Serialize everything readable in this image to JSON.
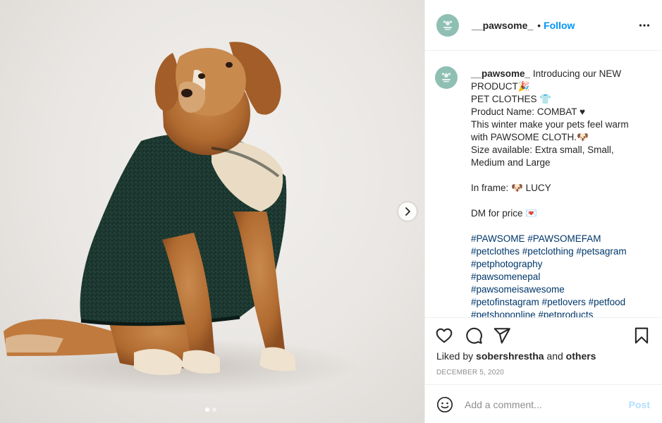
{
  "post": {
    "username": "__pawsome_",
    "follow_label": "Follow",
    "separator": "•",
    "caption": {
      "username": "__pawsome_",
      "lines": [
        "Introducing our NEW",
        "PRODUCT🎉",
        "PET CLOTHES 👕",
        "Product Name: COMBAT ♥",
        "This winter make your pets feel warm",
        "with PAWSOME CLOTH.🐶",
        "Size available: Extra small, Small,",
        "Medium and Large",
        "",
        "In frame: 🐶 LUCY",
        "",
        "DM for price 💌",
        ""
      ],
      "hashtag_lines": [
        "#PAWSOME #PAWSOMEFAM",
        "#petclothes #petclothing #petsagram",
        "#petphotography",
        "#pawsomenepal",
        "#pawsomeisawesome",
        "#petofinstagram #petlovers #petfood",
        "#petshoponline #petproducts"
      ]
    },
    "likes": {
      "prefix": "Liked by",
      "user": "sobershrestha",
      "and": "and",
      "others": "others"
    },
    "date": "DECEMBER 5, 2020",
    "comment": {
      "placeholder": "Add a comment...",
      "post_label": "Post"
    },
    "carousel": {
      "slides": 2,
      "active": 0
    }
  },
  "icons": {
    "more": "more-horizontal-icon",
    "like": "heart-icon",
    "comment": "comment-icon",
    "share": "share-icon",
    "save": "bookmark-icon",
    "emoji": "emoji-icon",
    "next": "chevron-right-icon"
  },
  "colors": {
    "accent": "#0095f6",
    "post_disabled": "#b2dffc",
    "hashtag": "#00376b",
    "avatar_bg": "#8fbfb3",
    "sweater": "#1e3b32"
  }
}
